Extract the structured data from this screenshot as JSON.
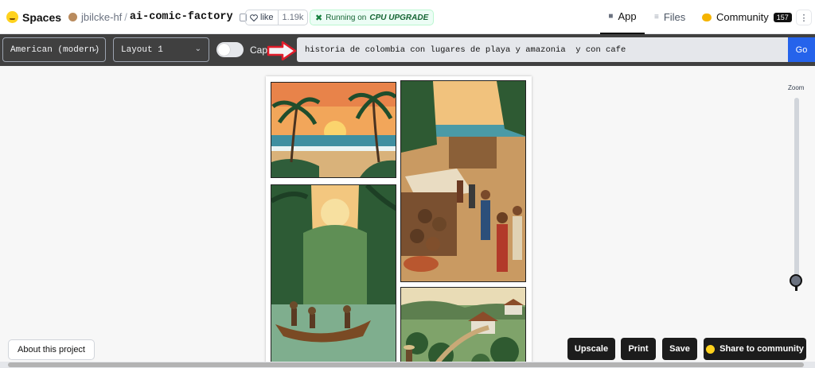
{
  "header": {
    "spaces_label": "Spaces",
    "owner": "jbilcke-hf",
    "separator": "/",
    "repo_name": "ai-comic-factory",
    "like_label": "like",
    "like_count": "1.19k",
    "status_prefix": "Running on",
    "status_hw": "CPU UPGRADE",
    "nav": {
      "app": "App",
      "files": "Files",
      "community": "Community",
      "community_count": "157"
    },
    "menu_icon": "⋮"
  },
  "toolbar": {
    "style_value": "American (modern)",
    "layout_value": "Layout 1",
    "caption_label": "Caption",
    "prompt_value": "historia de colombia con lugares de playa y amazonia  y con cafe",
    "go_label": "Go"
  },
  "zoom": {
    "label": "Zoom",
    "level": 0.05
  },
  "actions": {
    "about_label": "About this project",
    "upscale_label": "Upscale",
    "print_label": "Print",
    "save_label": "Save",
    "share_label": "Share to community"
  },
  "colors": {
    "go_button": "#2563eb",
    "toolbar_bg": "#404040",
    "annotation_arrow": "#e11d2b"
  },
  "icons": [
    "hugging-face-icon",
    "copy-icon",
    "heart-icon",
    "run-icon",
    "app-cube-icon",
    "files-icon",
    "community-icon",
    "chevron-down-icon",
    "red-arrow-annotation"
  ]
}
